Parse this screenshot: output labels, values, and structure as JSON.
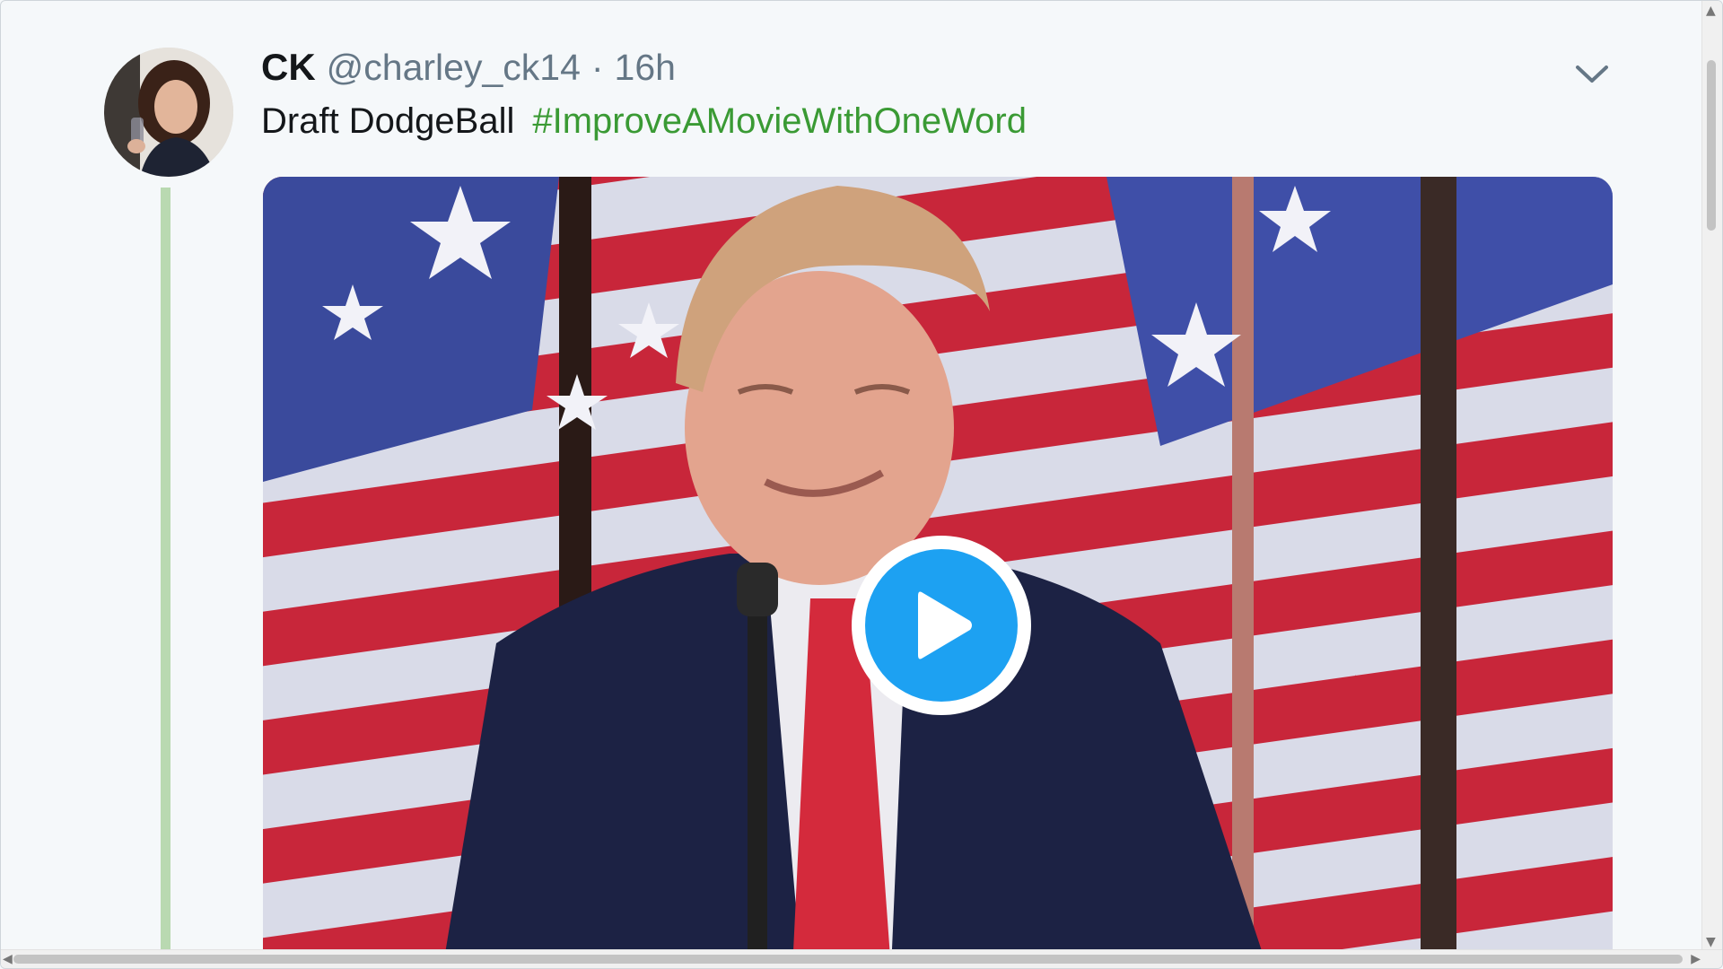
{
  "tweet": {
    "name": "CK",
    "handle": "@charley_ck14",
    "separator": "·",
    "time": "16h",
    "text": "Draft DodgeBall",
    "hashtag": "#ImproveAMovieWithOneWord"
  },
  "icons": {
    "menu": "chevron-down-icon",
    "media_play": "play-icon",
    "scroll_left": "chevron-left-icon",
    "scroll_right": "chevron-right-icon"
  },
  "colors": {
    "hashtag": "#3a9a34",
    "play": "#1da1f2",
    "thread_line": "#b9d9b1"
  }
}
